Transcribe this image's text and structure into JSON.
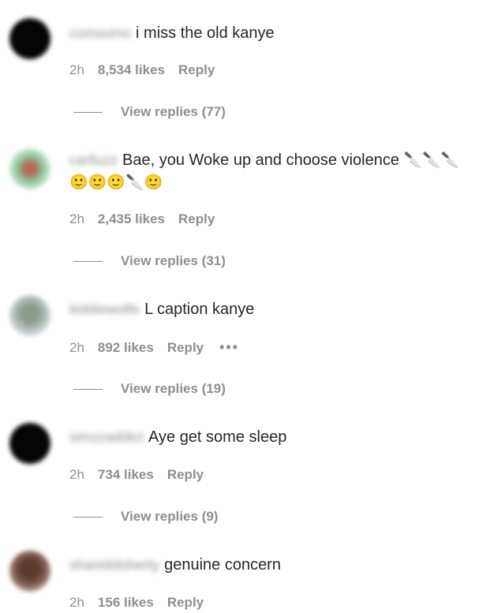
{
  "comments": [
    {
      "username": "comsumo",
      "text": "i miss the old kanye",
      "text_suffix": "",
      "second_line": "",
      "time": "2h",
      "likes": "8,534 likes",
      "reply_label": "Reply",
      "view_replies": "View replies (77)"
    },
    {
      "username": "carlluzz",
      "text": "Bae, you Woke up and choose violence",
      "text_suffix": "🔪🔪🔪",
      "second_line": "🙂🙂🙂🔪🙂",
      "time": "2h",
      "likes": "2,435 likes",
      "reply_label": "Reply",
      "view_replies": "View replies (31)"
    },
    {
      "username": "kiddiewolfe",
      "text": "L caption kanye",
      "text_suffix": "",
      "second_line": "",
      "time": "2h",
      "likes": "892 likes",
      "reply_label": "Reply",
      "more_label": "•••",
      "view_replies": "View replies (19)"
    },
    {
      "username": "simzzaddict",
      "text": "Aye get some sleep",
      "text_suffix": "",
      "second_line": "",
      "time": "2h",
      "likes": "734 likes",
      "reply_label": "Reply",
      "view_replies": "View replies (9)"
    },
    {
      "username": "shareitdoherty",
      "text": "genuine concern",
      "text_suffix": "",
      "second_line": "",
      "time": "2h",
      "likes": "156 likes",
      "reply_label": "Reply",
      "view_replies": ""
    }
  ]
}
